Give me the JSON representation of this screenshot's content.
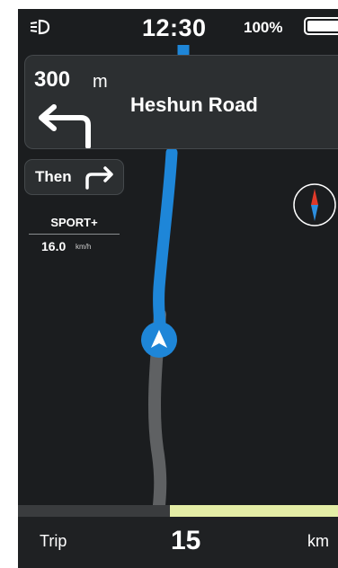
{
  "status": {
    "light_icon": "headlight-icon",
    "time": "12:30",
    "battery_percent": "100%",
    "battery_level": 1.0
  },
  "navigation": {
    "distance_value": "300",
    "distance_unit": "m",
    "turn_icon": "turn-left-arrow-icon",
    "street_name": "Heshun Road",
    "then_label": "Then",
    "then_icon": "turn-right-arrow-icon"
  },
  "riding": {
    "mode": "SPORT+",
    "speed": "16.0",
    "speed_unit": "km/h"
  },
  "map": {
    "route_color": "#1e86d8",
    "travelled_color": "#5f6163",
    "background_color": "#1b1d1f",
    "compass_icon": "compass-icon",
    "position_icon": "position-arrow-icon"
  },
  "trip": {
    "label": "Trip",
    "value": "15",
    "unit": "km",
    "progress": 0.53,
    "progress_color": "#e4eda6"
  }
}
